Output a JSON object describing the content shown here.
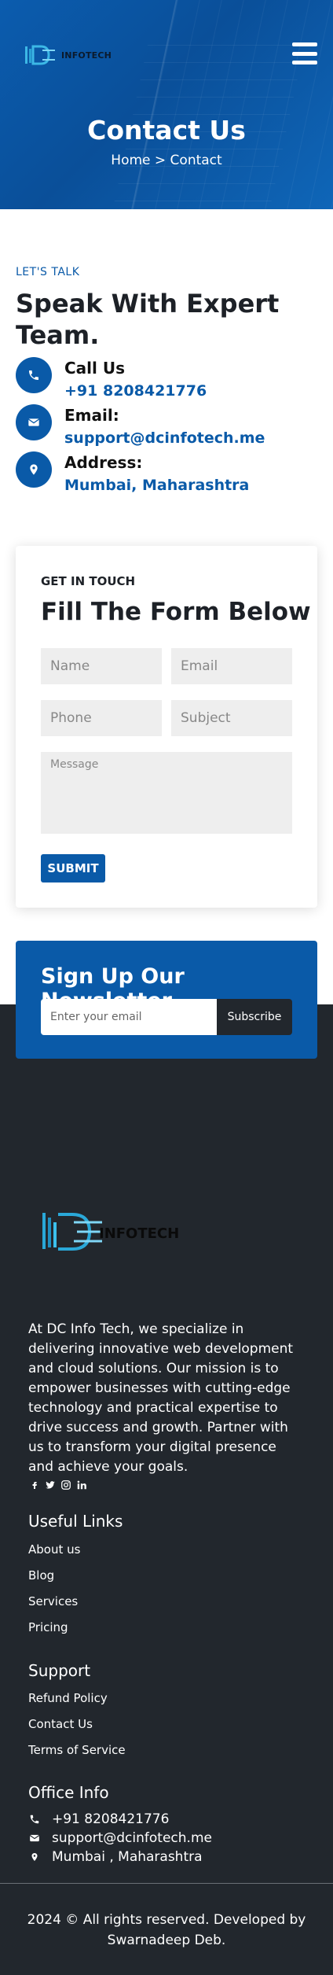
{
  "header": {
    "logo_text": "INFOTECH",
    "title": "Contact Us",
    "breadcrumb": "Home > Contact"
  },
  "talk": {
    "eyebrow": "LET'S TALK",
    "title": "Speak With Expert Team.",
    "items": [
      {
        "label": "Call Us",
        "value": "+91 8208421776",
        "icon": "phone-icon"
      },
      {
        "label": "Email:",
        "value": "support@dcinfotech.me",
        "icon": "envelope-icon"
      },
      {
        "label": "Address:",
        "value": "Mumbai, Maharashtra",
        "icon": "location-pin-icon"
      }
    ]
  },
  "form": {
    "eyebrow": "GET IN TOUCH",
    "title": "Fill The Form Below",
    "name_placeholder": "Name",
    "email_placeholder": "Email",
    "phone_placeholder": "Phone",
    "subject_placeholder": "Subject",
    "message_placeholder": "Message",
    "submit_label": "SUBMIT"
  },
  "newsletter": {
    "title": "Sign Up Our Newsletter",
    "placeholder": "Enter your email",
    "button_label": "Subscribe"
  },
  "footer": {
    "logo_text": "INFOTECH",
    "about": "At DC Info Tech, we specialize in delivering innovative web development and cloud solutions. Our mission is to empower businesses with cutting-edge technology and practical expertise to drive success and growth. Partner with us to transform your digital presence and achieve your goals.",
    "socials": [
      "facebook-icon",
      "twitter-icon",
      "instagram-icon",
      "linkedin-icon"
    ],
    "useful_links": {
      "heading": "Useful Links",
      "items": [
        "About us",
        "Blog",
        "Services",
        "Pricing"
      ]
    },
    "support": {
      "heading": "Support",
      "items": [
        "Refund Policy",
        "Contact Us",
        "Terms of Service"
      ]
    },
    "office": {
      "heading": "Office Info",
      "phone": "+91 8208421776",
      "email": "support@dcinfotech.me",
      "address": "Mumbai , Maharashtra"
    },
    "copyright": "2024 © All rights reserved. Developed by Swarnadeep Deb."
  },
  "colors": {
    "primary": "#0a5aa8",
    "footer_bg": "#22272d",
    "heading": "#1d2127"
  }
}
